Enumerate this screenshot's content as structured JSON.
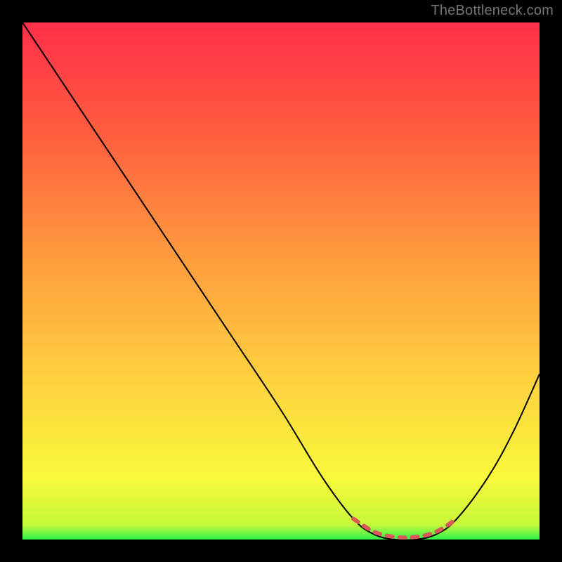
{
  "watermark": "TheBottleneck.com",
  "chart_data": {
    "type": "line",
    "title": "",
    "xlabel": "",
    "ylabel": "",
    "xlim": [
      0,
      100
    ],
    "ylim": [
      0,
      100
    ],
    "grid": false,
    "gradient_stops": [
      {
        "offset": 0,
        "color": "#30f54a"
      },
      {
        "offset": 3,
        "color": "#c8f83a"
      },
      {
        "offset": 12,
        "color": "#f9f93b"
      },
      {
        "offset": 30,
        "color": "#fed33f"
      },
      {
        "offset": 55,
        "color": "#ff9a3e"
      },
      {
        "offset": 80,
        "color": "#ff5a3e"
      },
      {
        "offset": 100,
        "color": "#ff2e4a"
      }
    ],
    "series": [
      {
        "name": "curve",
        "stroke": "#000000",
        "stroke_width": 2,
        "points": [
          {
            "x": 0,
            "y": 100
          },
          {
            "x": 10,
            "y": 85
          },
          {
            "x": 20,
            "y": 70
          },
          {
            "x": 30,
            "y": 55
          },
          {
            "x": 40,
            "y": 40
          },
          {
            "x": 50,
            "y": 25
          },
          {
            "x": 58,
            "y": 12
          },
          {
            "x": 64,
            "y": 4
          },
          {
            "x": 68,
            "y": 1
          },
          {
            "x": 72,
            "y": 0
          },
          {
            "x": 76,
            "y": 0
          },
          {
            "x": 80,
            "y": 1
          },
          {
            "x": 84,
            "y": 4
          },
          {
            "x": 90,
            "y": 12
          },
          {
            "x": 95,
            "y": 21
          },
          {
            "x": 100,
            "y": 32
          }
        ]
      },
      {
        "name": "lowband",
        "stroke": "#d95a59",
        "stroke_width": 6,
        "linecap": "round",
        "dash": "8 10",
        "points": [
          {
            "x": 64,
            "y": 4
          },
          {
            "x": 68,
            "y": 1.5
          },
          {
            "x": 72,
            "y": 0.5
          },
          {
            "x": 76,
            "y": 0.5
          },
          {
            "x": 80,
            "y": 1.5
          },
          {
            "x": 84,
            "y": 4
          }
        ]
      }
    ]
  }
}
